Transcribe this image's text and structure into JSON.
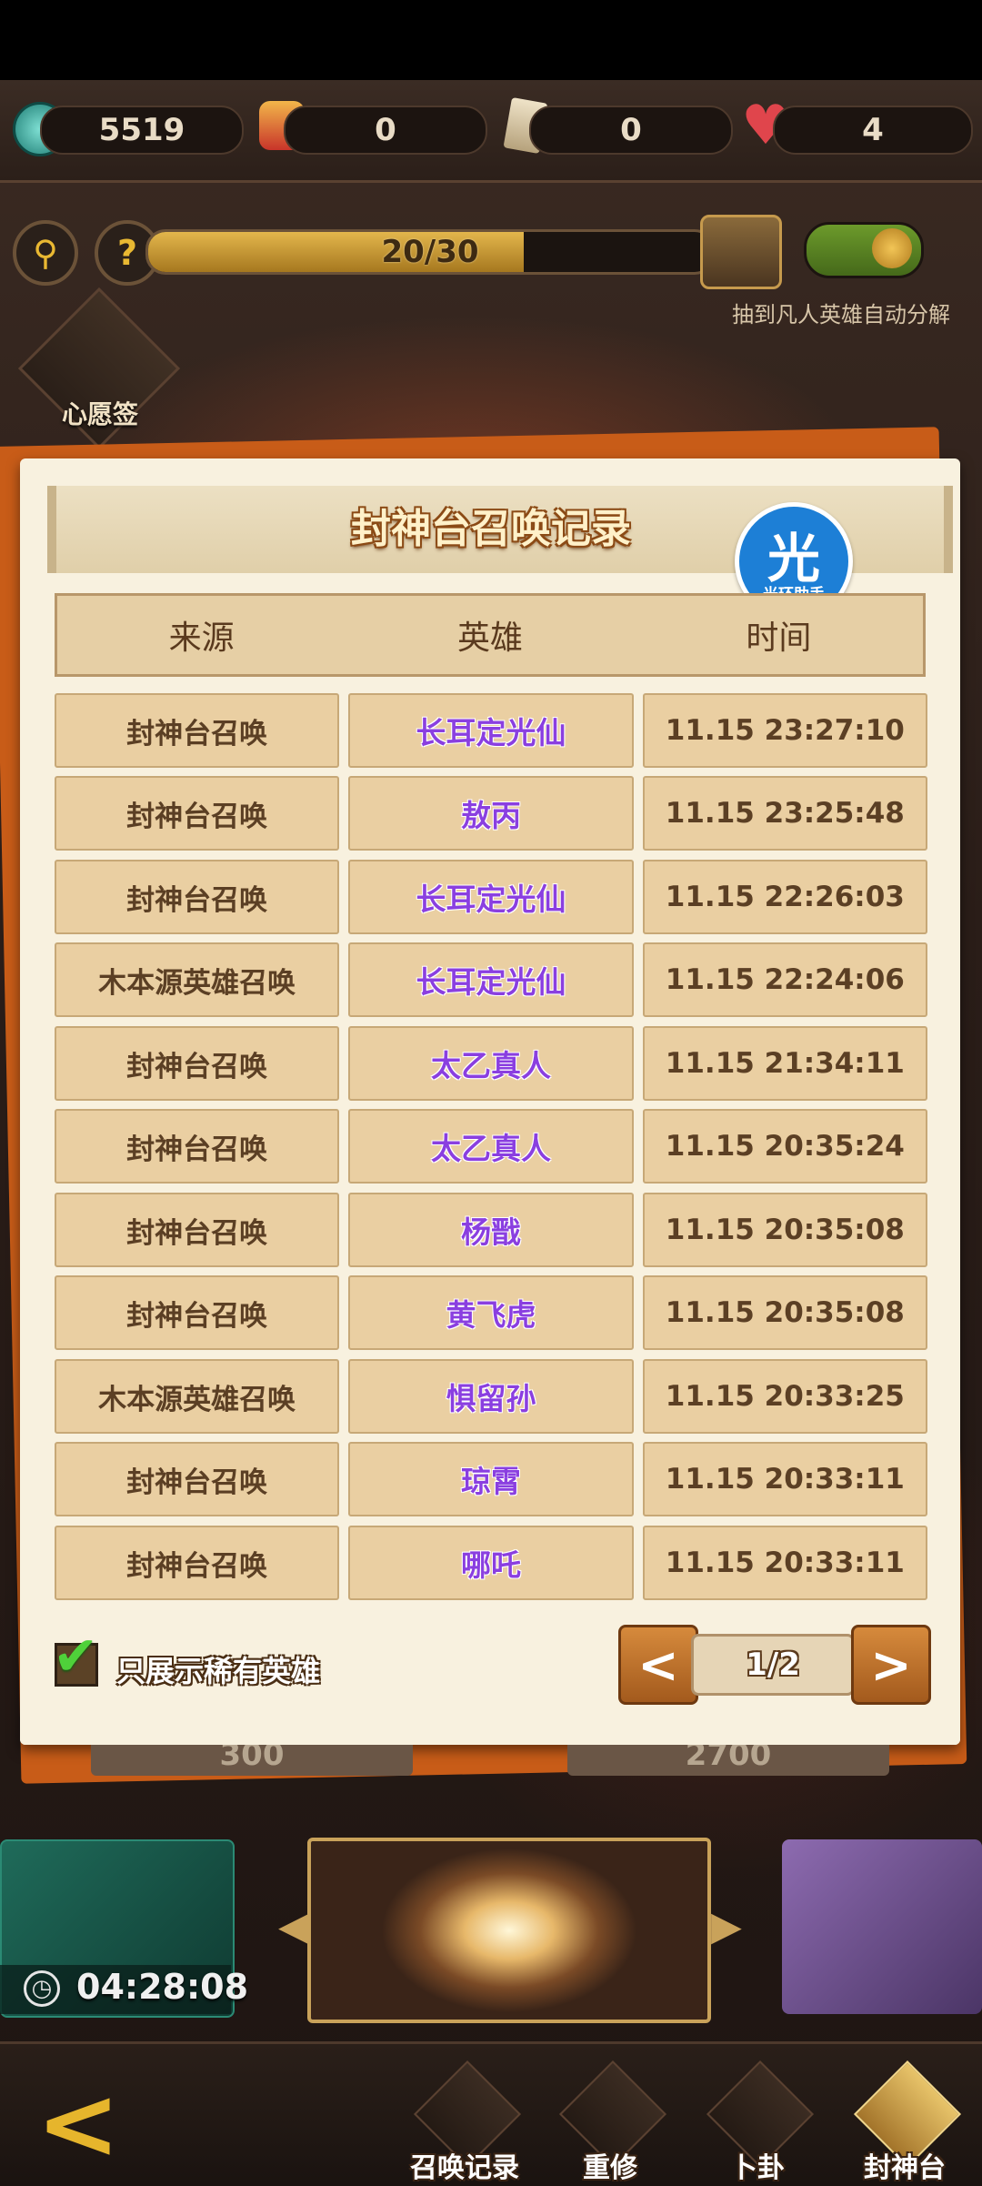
{
  "top_bar": {
    "items": [
      {
        "icon": "jade-coin-icon",
        "value": "5519"
      },
      {
        "icon": "lucky-cat-icon",
        "value": "0"
      },
      {
        "icon": "scroll-ticket-icon",
        "value": "0"
      },
      {
        "icon": "heart-icon",
        "value": "4"
      }
    ]
  },
  "summon": {
    "progress_text": "20/30",
    "progress_fraction": 0.6667,
    "auto_decompose_label": "抽到凡人英雄自动分解",
    "auto_decompose_on": true,
    "wish_label": "心愿签"
  },
  "dialog": {
    "title": "封神台召唤记录",
    "watermark_char": "光",
    "watermark_text": "光环助手",
    "columns": [
      "来源",
      "英雄",
      "时间"
    ],
    "rows": [
      {
        "source": "封神台召唤",
        "hero": "长耳定光仙",
        "time": "11.15 23:27:10"
      },
      {
        "source": "封神台召唤",
        "hero": "敖丙",
        "time": "11.15 23:25:48"
      },
      {
        "source": "封神台召唤",
        "hero": "长耳定光仙",
        "time": "11.15 22:26:03"
      },
      {
        "source": "木本源英雄召唤",
        "hero": "长耳定光仙",
        "time": "11.15 22:24:06"
      },
      {
        "source": "封神台召唤",
        "hero": "太乙真人",
        "time": "11.15 21:34:11"
      },
      {
        "source": "封神台召唤",
        "hero": "太乙真人",
        "time": "11.15 20:35:24"
      },
      {
        "source": "封神台召唤",
        "hero": "杨戬",
        "time": "11.15 20:35:08"
      },
      {
        "source": "封神台召唤",
        "hero": "黄飞虎",
        "time": "11.15 20:35:08"
      },
      {
        "source": "木本源英雄召唤",
        "hero": "惧留孙",
        "time": "11.15 20:33:25"
      },
      {
        "source": "封神台召唤",
        "hero": "琼霄",
        "time": "11.15 20:33:11"
      },
      {
        "source": "封神台召唤",
        "hero": "哪吒",
        "time": "11.15 20:33:11"
      }
    ],
    "filter_label": "只展示稀有英雄",
    "filter_checked": true,
    "prev_label": "<",
    "next_label": ">",
    "page_text": "1/2"
  },
  "behind": {
    "cost_left": "300",
    "cost_right": "2700",
    "timer": "04:28:08"
  },
  "bottom_nav": [
    {
      "label": "召唤记录"
    },
    {
      "label": "重修"
    },
    {
      "label": "卜卦"
    },
    {
      "label": "封神台"
    }
  ],
  "colors": {
    "hero_purple": "#8a3fe0",
    "dialog_bg": "#f8f1df",
    "cell_bg": "#eacfa2",
    "accent_orange": "#c85c18",
    "check_green": "#4fd13a"
  }
}
